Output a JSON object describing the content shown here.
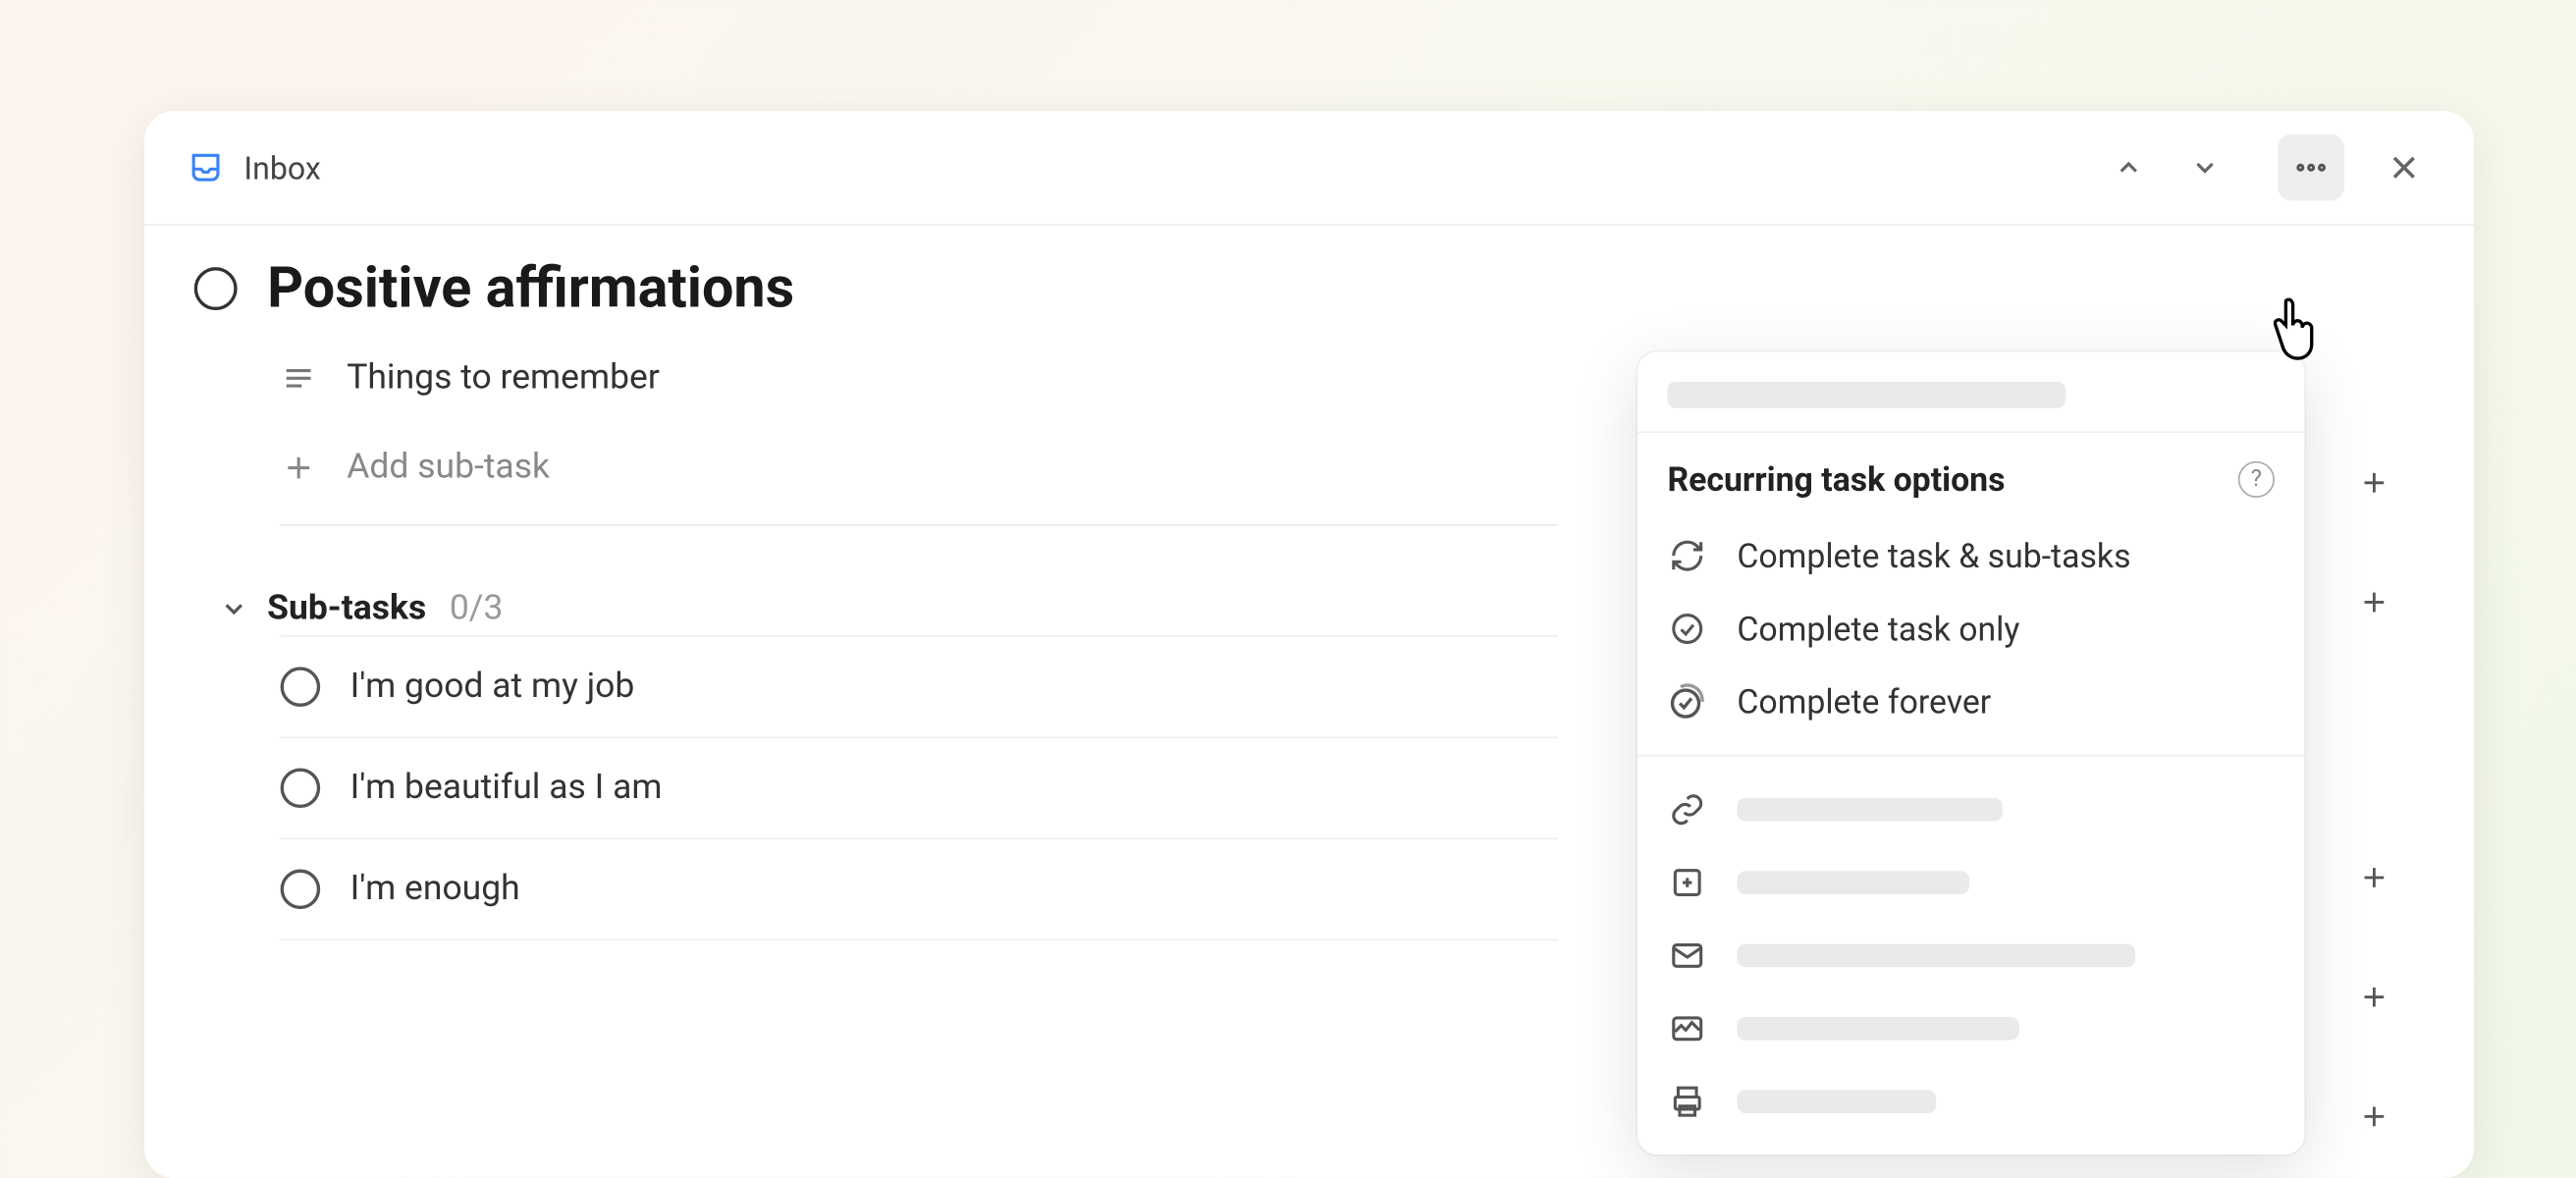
{
  "header": {
    "location_label": "Inbox"
  },
  "task": {
    "title": "Positive affirmations",
    "description": "Things to remember",
    "add_subtask_label": "Add sub-task"
  },
  "subtasks": {
    "label": "Sub-tasks",
    "count": "0/3",
    "items": [
      {
        "text": "I'm good at my job"
      },
      {
        "text": "I'm beautiful as I am"
      },
      {
        "text": "I'm enough"
      }
    ]
  },
  "dropdown": {
    "section_title": "Recurring task options",
    "options": [
      {
        "label": "Complete task & sub-tasks",
        "icon": "refresh"
      },
      {
        "label": "Complete task only",
        "icon": "check-circle"
      },
      {
        "label": "Complete forever",
        "icon": "double-check-circle"
      }
    ]
  }
}
